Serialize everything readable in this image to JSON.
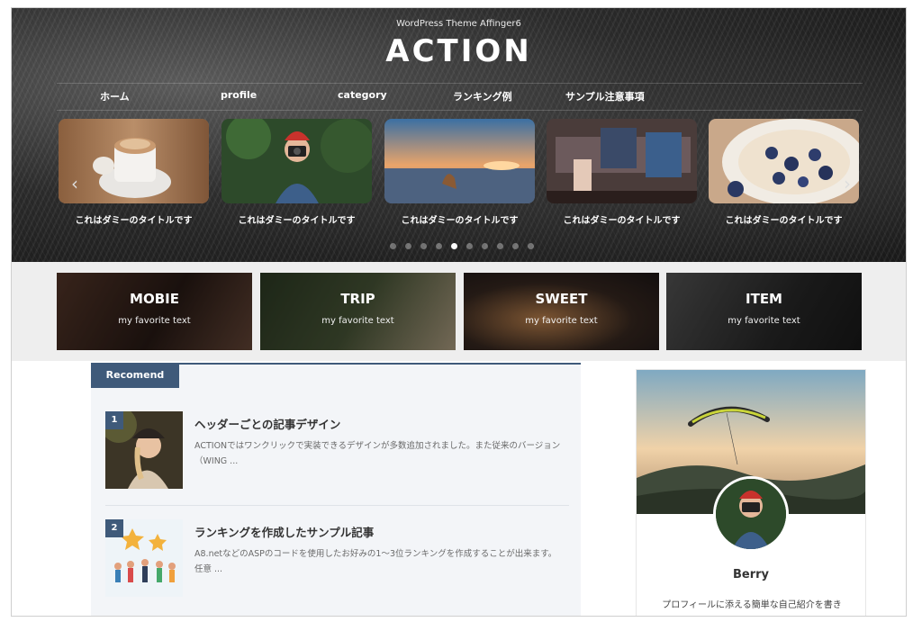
{
  "header": {
    "theme_line": "WordPress Theme Affinger6",
    "logo": "ACTION"
  },
  "nav": {
    "items": [
      {
        "label": "ホーム"
      },
      {
        "label": "profile"
      },
      {
        "label": "category"
      },
      {
        "label": "ランキング例"
      },
      {
        "label": "サンプル注意事項"
      }
    ]
  },
  "slider": {
    "slides": [
      {
        "title": "これはダミーのタイトルです",
        "image": "coffee-cup-photo"
      },
      {
        "title": "これはダミーのタイトルです",
        "image": "camera-girl-photo"
      },
      {
        "title": "これはダミーのタイトルです",
        "image": "dog-beach-sunset-photo"
      },
      {
        "title": "これはダミーのタイトルです",
        "image": "couple-sofa-photo"
      },
      {
        "title": "これはダミーのタイトルです",
        "image": "blueberry-yogurt-photo"
      }
    ],
    "prev_icon": "chevron-left-icon",
    "next_icon": "chevron-right-icon",
    "dot_count": 10,
    "active_dot": 5
  },
  "categories": [
    {
      "title": "MOBIE",
      "subtitle": "my favorite text"
    },
    {
      "title": "TRIP",
      "subtitle": "my favorite text"
    },
    {
      "title": "SWEET",
      "subtitle": "my favorite text"
    },
    {
      "title": "ITEM",
      "subtitle": "my favorite text"
    }
  ],
  "recommend": {
    "tab_label": "Recomend",
    "items": [
      {
        "rank": "1",
        "title": "ヘッダーごとの記事デザイン",
        "excerpt": "ACTIONではワンクリックで実装できるデザインが多数追加されました。また従来のバージョン（WING ..."
      },
      {
        "rank": "2",
        "title": "ランキングを作成したサンプル記事",
        "excerpt": "A8.netなどのASPのコードを使用したお好みの1～3位ランキングを作成することが出来ます。 任意 ..."
      }
    ]
  },
  "profile": {
    "name": "Berry",
    "bio": "プロフィールに添える簡単な自己紹介を書き"
  },
  "colors": {
    "accent": "#3f5a7a",
    "band_bg": "#eeeeee",
    "recommend_bg": "#f3f5f8"
  }
}
